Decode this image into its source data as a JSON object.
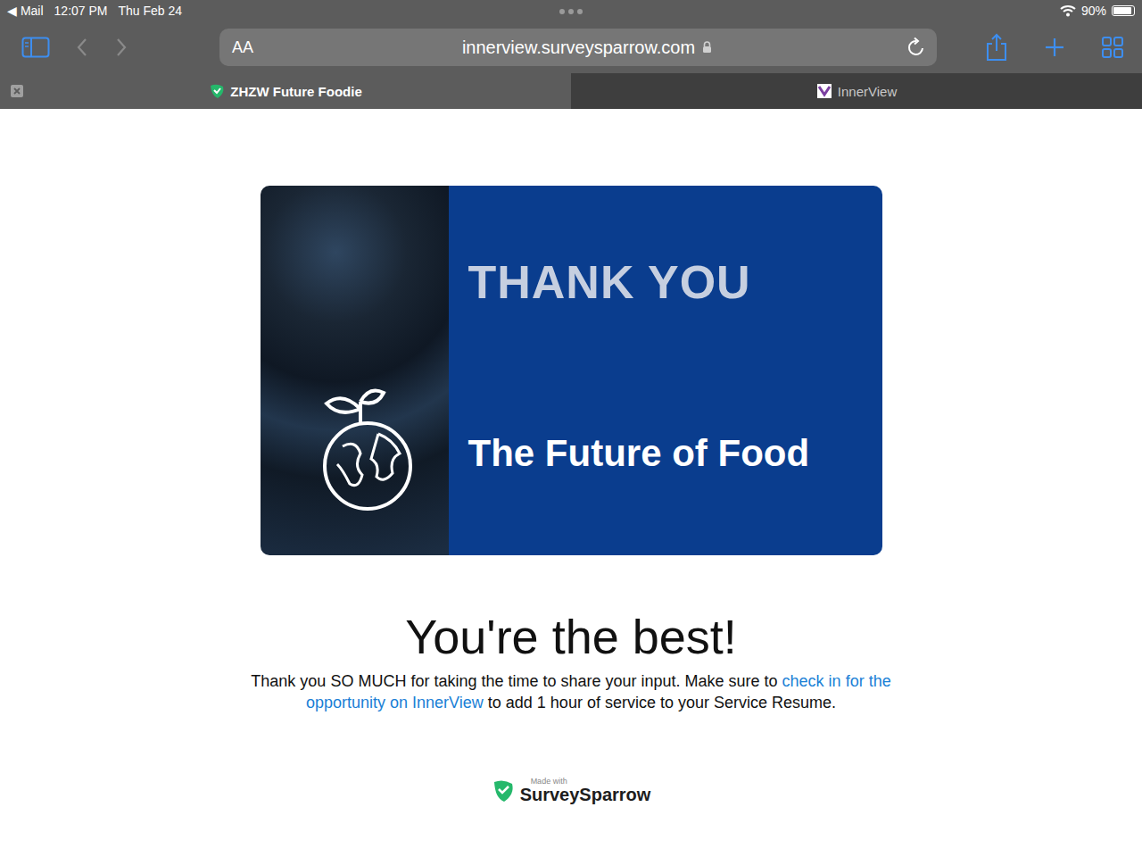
{
  "status_bar": {
    "back": "◀ Mail",
    "time": "12:07 PM",
    "date": "Thu Feb 24",
    "battery": "90%",
    "battery_level": 0.9
  },
  "toolbar": {
    "text_size": "AA",
    "url": "innerview.surveysparrow.com"
  },
  "tabs": [
    {
      "label": "ZHZW Future Foodie",
      "selected": true
    },
    {
      "label": "InnerView",
      "selected": false
    }
  ],
  "banner": {
    "title": "THANK YOU",
    "subtitle": "The Future of Food"
  },
  "heading": "You're the best!",
  "message": {
    "before": "Thank you SO MUCH for taking the time to share your input. Make sure to ",
    "link": "check in for the opportunity on InnerView",
    "after": " to add 1 hour of service to your Service Resume."
  },
  "footer": {
    "made_with": "Made with",
    "brand": "SurveySparrow"
  }
}
